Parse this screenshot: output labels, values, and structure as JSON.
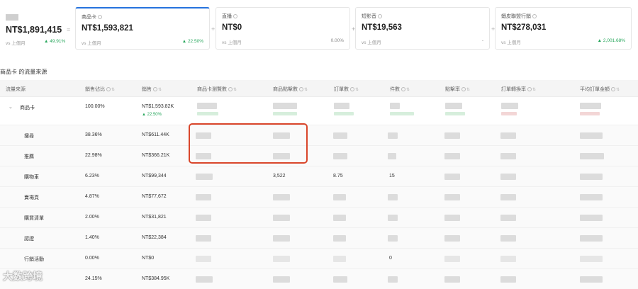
{
  "summary": {
    "total": {
      "value": "NT$1,891,415",
      "vs": "vs 上個月",
      "change": "▲ 49.91%"
    },
    "cards": [
      {
        "title": "商品卡",
        "value": "NT$1,593,821",
        "vs": "vs 上個月",
        "change": "▲ 22.50%"
      },
      {
        "title": "直播",
        "value": "NT$0",
        "vs": "vs 上個月",
        "change": "0.00%"
      },
      {
        "title": "短影音",
        "value": "NT$19,563",
        "vs": "vs 上個月",
        "change": "-"
      },
      {
        "title": "蝦皮聯盟行銷",
        "value": "NT$278,031",
        "vs": "vs 上個月",
        "change": "▲ 2,001.68%"
      }
    ]
  },
  "section_title": "商品卡 的流量來源",
  "table": {
    "headers": [
      "流量來源",
      "銷售佔比",
      "銷售",
      "商品卡瀏覽數",
      "商品點擊數",
      "訂單數",
      "件數",
      "點擊率",
      "訂單轉換率",
      "平均訂單金額"
    ],
    "rows": [
      {
        "source": "商品卡",
        "share": "100.00%",
        "sales": "NT$1,593.82K",
        "sales_change": "▲ 22.50%"
      },
      {
        "source": "搜尋",
        "share": "38.36%",
        "sales": "NT$611.44K"
      },
      {
        "source": "推薦",
        "share": "22.98%",
        "sales": "NT$366.21K"
      },
      {
        "source": "購物車",
        "share": "6.23%",
        "sales": "NT$99,344",
        "clicks": "3,522",
        "orders": "8.75",
        "units": "15"
      },
      {
        "source": "賣場頁",
        "share": "4.87%",
        "sales": "NT$77,672"
      },
      {
        "source": "購買清單",
        "share": "2.00%",
        "sales": "NT$31,821"
      },
      {
        "source": "認證",
        "share": "1.40%",
        "sales": "NT$22,384"
      },
      {
        "source": "行銷活動",
        "share": "0.00%",
        "sales": "NT$0",
        "units": "0"
      },
      {
        "source": "",
        "share": "24.15%",
        "sales": "NT$384.95K"
      }
    ]
  },
  "watermark": "大数跨境",
  "colors": {
    "accent": "#2673dd",
    "positive": "#26a65b",
    "highlight": "#d9462b"
  }
}
